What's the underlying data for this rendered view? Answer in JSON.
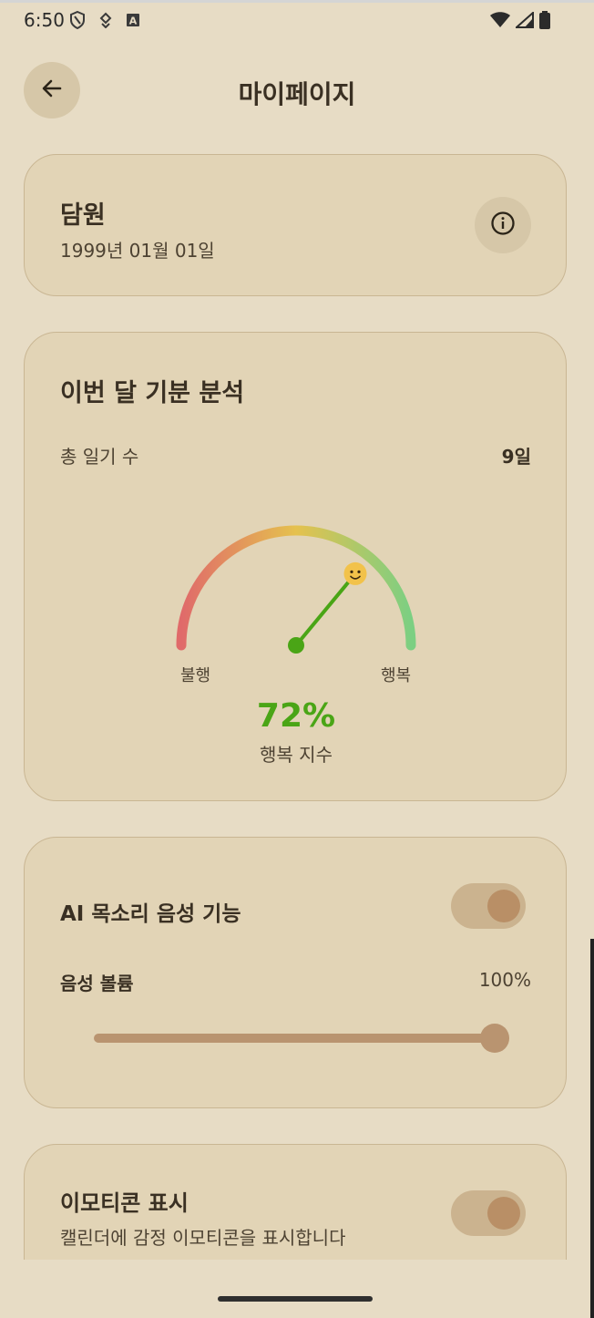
{
  "status_bar": {
    "time": "6:50",
    "left_icons": [
      "shield-icon",
      "location-icon",
      "keyboard-a-icon"
    ],
    "right_icons": [
      "wifi-icon",
      "signal-icon",
      "battery-icon"
    ]
  },
  "header": {
    "title": "마이페이지",
    "back_icon": "arrow-left-icon"
  },
  "profile": {
    "name": "담원",
    "birth_date": "1999년 01월 01일",
    "info_icon": "info-icon"
  },
  "mood_analysis": {
    "title": "이번 달 기분 분석",
    "diary_count_label": "총 일기 수",
    "diary_count_value": "9일",
    "gauge_left_label": "불행",
    "gauge_right_label": "행복",
    "happiness_value": "72%",
    "happiness_fraction": 0.72,
    "happiness_label": "행복 지수",
    "colors": {
      "unhappy": "#e06a6a",
      "neutral": "#e5c14e",
      "happy": "#7ccf82",
      "needle": "#4aa516"
    }
  },
  "voice_settings": {
    "title": "AI 목소리 음성 기능",
    "enabled": true,
    "volume_label": "음성 볼륨",
    "volume_value": "100%",
    "volume_fraction": 1.0
  },
  "emoticon_settings": {
    "title": "이모티콘 표시",
    "description": "캘린더에 감정 이모티콘을 표시합니다",
    "enabled": true
  }
}
